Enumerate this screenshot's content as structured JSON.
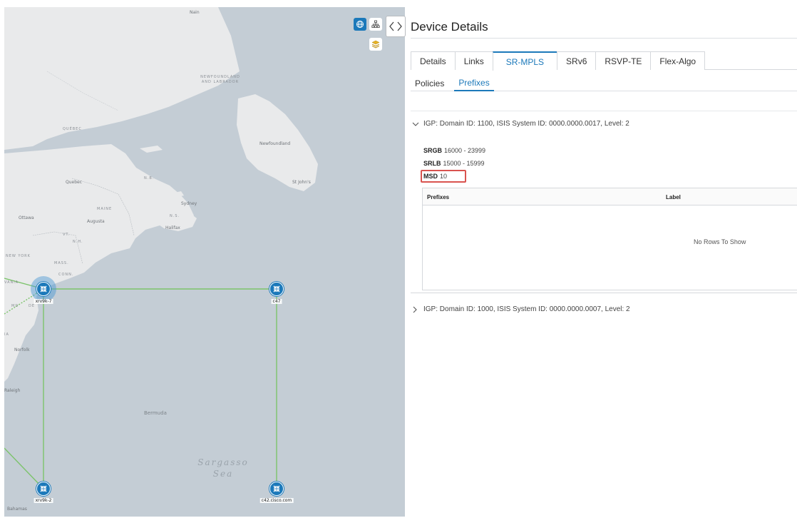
{
  "map": {
    "labels": {
      "nain": "Nain",
      "newfoundland_labrador": "NEWFOUNDLAND AND LABRADOR",
      "quebec_region": "QUÉBEC",
      "quebec_city": "Quebec",
      "newfoundland": "Newfoundland",
      "st_johns": "St John's",
      "nb": "N.B.",
      "ns": "N.S.",
      "sydney": "Sydney",
      "maine": "MAINE",
      "augusta": "Augusta",
      "halifax": "Halifax",
      "ottawa": "Ottawa",
      "vt": "VT.",
      "nh": "N.H.",
      "new_york": "NEW YORK",
      "mass": "MASS.",
      "conn": "CONN.",
      "vania": "VANIA",
      "md": "MD",
      "de": "DE",
      "norfolk": "Norfolk",
      "ja": "IA",
      "raleigh": "Raleigh",
      "bermuda": "Bermuda",
      "sargasso_sea": "Sargasso Sea",
      "bahamas": "Bahamas"
    },
    "nodes": [
      {
        "id": "xrv9k-7",
        "label": "xrv9k-7"
      },
      {
        "id": "c47",
        "label": "c47"
      },
      {
        "id": "xrv9k-2",
        "label": "xrv9k-2"
      },
      {
        "id": "c42",
        "label": "c42.cisco.com"
      }
    ],
    "controls": {
      "globe_icon": "globe-icon",
      "topology_icon": "topology-icon",
      "layers_icon": "layers-icon"
    },
    "colors": {
      "link": "#7cc36b",
      "node": "#1c79ba",
      "water": "#c4cdd5",
      "land": "#e9eaeb"
    }
  },
  "panel": {
    "title": "Device Details",
    "tabs": [
      "Details",
      "Links",
      "SR-MPLS",
      "SRv6",
      "RSVP-TE",
      "Flex-Algo"
    ],
    "active_tab": "SR-MPLS",
    "subtabs": [
      "Policies",
      "Prefixes"
    ],
    "active_subtab": "Prefixes",
    "igp_sections": [
      {
        "header": "IGP: Domain ID: 1100, ISIS System ID: 0000.0000.0017, Level: 2",
        "expanded": true,
        "srgb_label": "SRGB",
        "srgb_value": "16000 - 23999",
        "srlb_label": "SRLB",
        "srlb_value": "15000 - 15999",
        "msd_label": "MSD",
        "msd_value": "10",
        "table": {
          "columns": [
            "Prefixes",
            "Label"
          ],
          "empty_text": "No Rows To Show"
        }
      },
      {
        "header": "IGP: Domain ID: 1000, ISIS System ID: 0000.0000.0007, Level: 2",
        "expanded": false
      }
    ],
    "colors": {
      "accent": "#1c79ba",
      "highlight": "#d9534f"
    }
  }
}
